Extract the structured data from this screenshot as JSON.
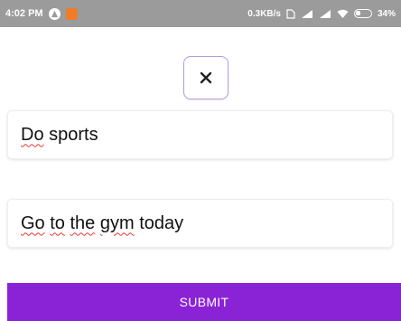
{
  "status_bar": {
    "time": "4:02 PM",
    "network_speed": "0.3KB/s",
    "battery": "34%",
    "icons": [
      "notification-icon",
      "app-icon",
      "signal-icon",
      "signal-icon",
      "wifi-icon",
      "battery-icon"
    ]
  },
  "close_icon": "×",
  "fields": [
    {
      "words": [
        {
          "text": "Do",
          "spell": true
        },
        {
          "text": " sports",
          "spell": false
        }
      ]
    },
    {
      "words": [
        {
          "text": "Go",
          "spell": true
        },
        {
          "text": " ",
          "spell": false
        },
        {
          "text": "to",
          "spell": true
        },
        {
          "text": " ",
          "spell": false
        },
        {
          "text": "the",
          "spell": true
        },
        {
          "text": " ",
          "spell": false
        },
        {
          "text": "gym",
          "spell": true
        },
        {
          "text": " today",
          "spell": false
        }
      ]
    }
  ],
  "submit_label": "SUBMIT",
  "colors": {
    "accent": "#8a22d6",
    "close_border": "#b39ddb",
    "status_bar_bg": "#9b9b9b",
    "spellcheck": "#e53935"
  }
}
